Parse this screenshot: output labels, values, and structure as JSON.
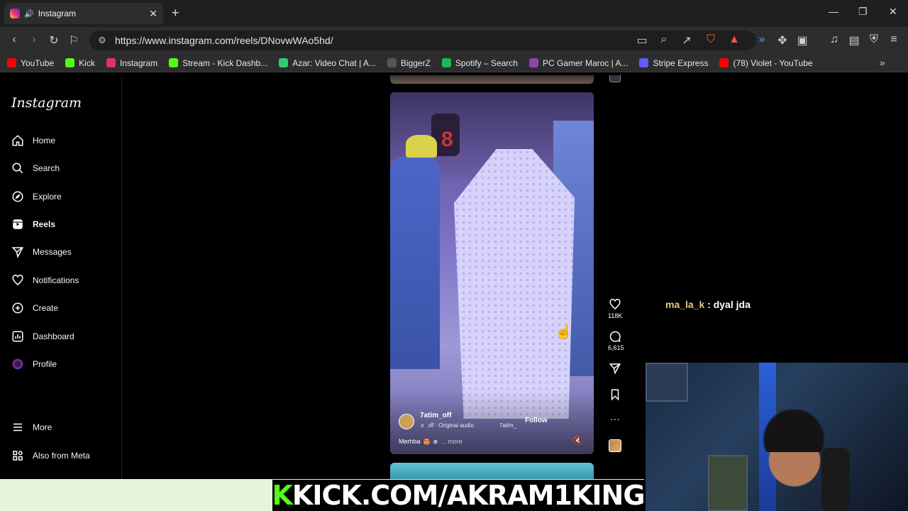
{
  "browser": {
    "tab_title": "Instagram",
    "url": "https://www.instagram.com/reels/DNovwWAo5hd/",
    "bookmarks": [
      {
        "label": "YouTube",
        "color": "#ff0000"
      },
      {
        "label": "Kick",
        "color": "#53fc18"
      },
      {
        "label": "Instagram",
        "color": "#e1306c"
      },
      {
        "label": "Stream - Kick Dashb...",
        "color": "#53fc18"
      },
      {
        "label": "Azar: Video Chat | A...",
        "color": "#2ecc71"
      },
      {
        "label": "BiggerZ",
        "color": "#555555"
      },
      {
        "label": "Spotify – Search",
        "color": "#1db954"
      },
      {
        "label": "PC Gamer Maroc | A...",
        "color": "#8e44ad"
      },
      {
        "label": "Stripe Express",
        "color": "#635bff"
      },
      {
        "label": "(78) Violet - YouTube",
        "color": "#ff0000"
      }
    ]
  },
  "sidebar": {
    "logo": "Instagram",
    "items": [
      {
        "label": "Home",
        "icon": "home-icon"
      },
      {
        "label": "Search",
        "icon": "search-icon"
      },
      {
        "label": "Explore",
        "icon": "compass-icon"
      },
      {
        "label": "Reels",
        "icon": "reels-icon"
      },
      {
        "label": "Messages",
        "icon": "messages-icon"
      },
      {
        "label": "Notifications",
        "icon": "heart-icon"
      },
      {
        "label": "Create",
        "icon": "plus-icon"
      },
      {
        "label": "Dashboard",
        "icon": "dashboard-icon"
      },
      {
        "label": "Profile",
        "icon": "avatar"
      }
    ],
    "more": "More",
    "also_meta": "Also from Meta"
  },
  "reel": {
    "username": "7atim_off",
    "audio": "ɔff · Original audio",
    "tagged": "7atim_",
    "follow": "Follow",
    "caption": "Merhba",
    "more": "... more",
    "likes": "118K",
    "comments": "6,615"
  },
  "stream": {
    "chat_user": "ma_la_k",
    "chat_message": ": dyal jda",
    "banner_k": "K",
    "banner_text": "KICK.COM/AKRAM1KING"
  }
}
